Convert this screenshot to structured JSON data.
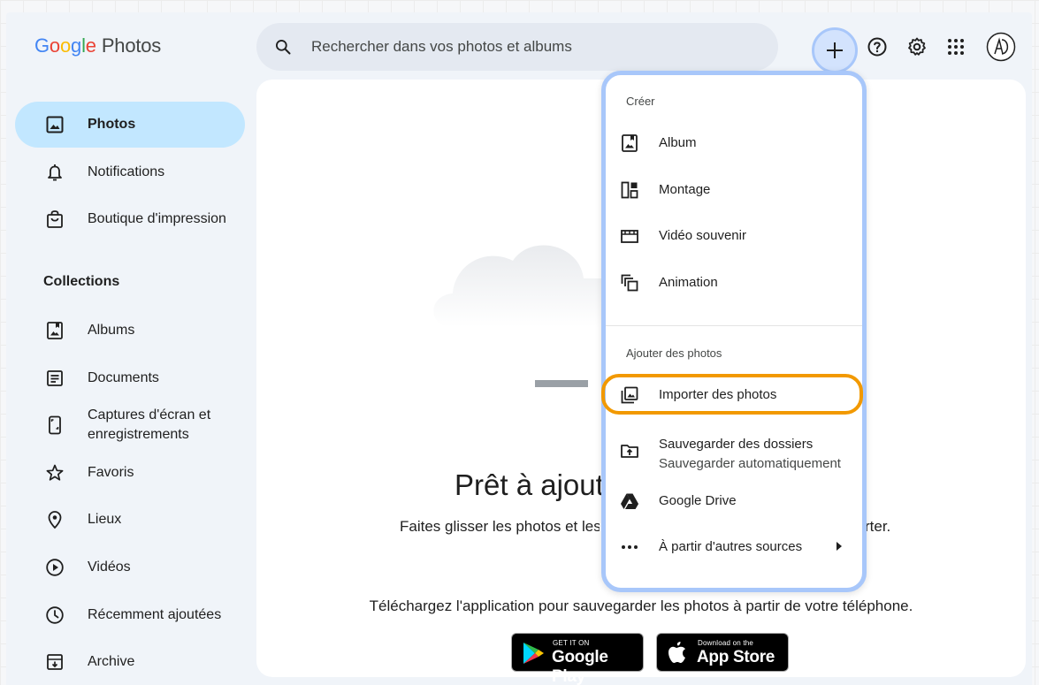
{
  "app": {
    "logo_google": [
      "G",
      "o",
      "o",
      "g",
      "l",
      "e"
    ],
    "logo_photos": "Photos"
  },
  "search": {
    "placeholder": "Rechercher dans vos photos et albums"
  },
  "header": {
    "create_icon": "plus-icon",
    "help_icon": "help-icon",
    "settings_icon": "gear-icon",
    "apps_icon": "apps-grid-icon",
    "account_initials": "AD"
  },
  "sidebar": {
    "items": [
      {
        "label": "Photos",
        "icon": "photo-icon",
        "active": true
      },
      {
        "label": "Notifications",
        "icon": "bell-icon"
      },
      {
        "label": "Boutique d'impression",
        "icon": "shopping-bag-icon"
      }
    ],
    "collections_title": "Collections",
    "collections": [
      {
        "label": "Albums",
        "icon": "album-icon"
      },
      {
        "label": "Documents",
        "icon": "document-icon"
      },
      {
        "label": "Captures d'écran et",
        "label2": "enregistrements",
        "icon": "phone-screenshot-icon"
      },
      {
        "label": "Favoris",
        "icon": "star-icon"
      },
      {
        "label": "Lieux",
        "icon": "location-pin-icon"
      },
      {
        "label": "Vidéos",
        "icon": "play-circle-icon"
      },
      {
        "label": "Récemment ajoutées",
        "icon": "clock-icon"
      },
      {
        "label": "Archive",
        "icon": "archive-icon"
      }
    ]
  },
  "main": {
    "headline": "Prêt à ajouter des photos ?",
    "subline_left": "Faites glisser les photos et les vidéos ici pour les importer.",
    "subline_right": "rter.",
    "download_text": "Téléchargez l'application pour sauvegarder les photos à partir de votre téléphone.",
    "google_play_small": "GET IT ON",
    "google_play_big": "Google Play",
    "app_store_small": "Download on the",
    "app_store_big": "App Store"
  },
  "menu": {
    "section_create": "Créer",
    "create_items": [
      {
        "label": "Album",
        "icon": "album-icon"
      },
      {
        "label": "Montage",
        "icon": "collage-icon"
      },
      {
        "label": "Vidéo souvenir",
        "icon": "movie-icon"
      },
      {
        "label": "Animation",
        "icon": "animation-icon"
      }
    ],
    "section_add": "Ajouter des photos",
    "add_items": [
      {
        "label": "Importer des photos",
        "icon": "import-photos-icon",
        "highlighted": true
      },
      {
        "label": "Sauvegarder des dossiers",
        "sub": "Sauvegarder automatiquement",
        "icon": "folder-upload-icon"
      },
      {
        "label": "Google Drive",
        "icon": "google-drive-icon"
      },
      {
        "label": "À partir d'autres sources",
        "icon": "more-horiz-icon",
        "has_submenu": true
      }
    ]
  },
  "colors": {
    "accent_blue": "#a8c7fa",
    "highlight_orange": "#f29900",
    "active_nav": "#c2e7ff",
    "window_bg": "#f0f4f9"
  }
}
